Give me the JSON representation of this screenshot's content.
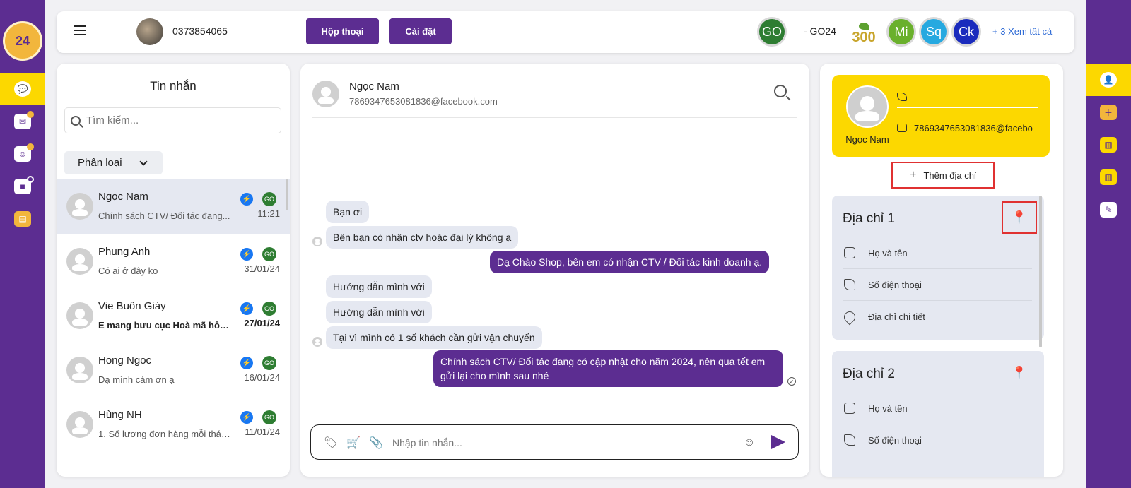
{
  "brand": {
    "logo_text": "24"
  },
  "topbar": {
    "phone": "0373854065",
    "buttons": {
      "conversations": "Hộp thoại",
      "settings": "Cài đặt"
    },
    "pages": [
      {
        "label": "GO",
        "color": "#2e7d32"
      },
      {
        "label": "Mi",
        "color": "#6ab02c"
      },
      {
        "label": "Sq",
        "color": "#26a9e0"
      },
      {
        "label": "Ck",
        "color": "#1a2bbd"
      }
    ],
    "go24_text": "- GO24",
    "plant_num": "300",
    "see_all": "+ 3 Xem tất cả"
  },
  "left_rail": {
    "items": [
      {
        "name": "chat-icon",
        "active": true
      },
      {
        "name": "mail-icon",
        "active": false
      },
      {
        "name": "inbox-icon",
        "active": false
      },
      {
        "name": "notification-icon",
        "active": false
      },
      {
        "name": "book-icon",
        "active": false
      }
    ]
  },
  "right_rail": {
    "items": [
      {
        "name": "user-icon",
        "active": true
      },
      {
        "name": "add-folder-icon",
        "active": false
      },
      {
        "name": "clipboard-icon",
        "active": false
      },
      {
        "name": "clipboard-icon",
        "active": false
      },
      {
        "name": "edit-card-icon",
        "active": false
      }
    ]
  },
  "list": {
    "title": "Tin nhắn",
    "search_placeholder": "Tìm kiếm...",
    "filter_label": "Phân loại",
    "conversations": [
      {
        "name": "Ngọc Nam",
        "preview": "Chính sách CTV/ Đối tác đang...",
        "time": "11:21",
        "go": "GO"
      },
      {
        "name": "Phung Anh",
        "preview": "Có ai ở đây ko",
        "time": "31/01/24",
        "go": "GO"
      },
      {
        "name": "Vie Buôn Giày",
        "preview": "E mang bưu cục Hoà mã hôm...",
        "time": "27/01/24",
        "go": "GO"
      },
      {
        "name": "Hong Ngoc",
        "preview": "Dạ mình cám ơn ạ",
        "time": "16/01/24",
        "go": "GO"
      },
      {
        "name": "Hùng NH",
        "preview": "1. Số lương đơn hàng mỗi thán...",
        "time": "11/01/24",
        "go": "GO"
      }
    ]
  },
  "chat": {
    "name": "Ngọc Nam",
    "email": "7869347653081836@facebook.com",
    "messages": [
      {
        "dir": "in",
        "text": "Bạn ơi"
      },
      {
        "dir": "in",
        "text": "Bên bạn có nhận ctv hoặc đại lý không ạ"
      },
      {
        "dir": "out",
        "text": "Dạ Chào Shop, bên em có nhận CTV / Đối tác kinh doanh ạ."
      },
      {
        "dir": "in",
        "text": "Hướng dẫn mình với"
      },
      {
        "dir": "in",
        "text": "Hướng dẫn mình với"
      },
      {
        "dir": "in",
        "text": "Tại vì mình có 1 số khách cần gửi vận chuyển"
      },
      {
        "dir": "out",
        "text": "Chính sách CTV/ Đối tác đang có cập nhật cho năm 2024, nên qua tết em gửi lại cho mình sau nhé"
      }
    ],
    "input_placeholder": "Nhập tin nhắn..."
  },
  "contact": {
    "name": "Ngọc Nam",
    "phone": "",
    "email": "7869347653081836@facebo",
    "add_address": "Thêm địa chỉ",
    "addresses": [
      {
        "title": "Địa chỉ 1",
        "fields": {
          "name": "Họ và tên",
          "phone": "Số điện thoại",
          "detail": "Địa chỉ chi tiết"
        }
      },
      {
        "title": "Địa chỉ 2",
        "fields": {
          "name": "Họ và tên",
          "phone": "Số điện thoại"
        }
      }
    ]
  },
  "colors": {
    "brand_purple": "#5c2d91",
    "accent_yellow": "#fcd800",
    "highlight_red": "#e03131"
  }
}
